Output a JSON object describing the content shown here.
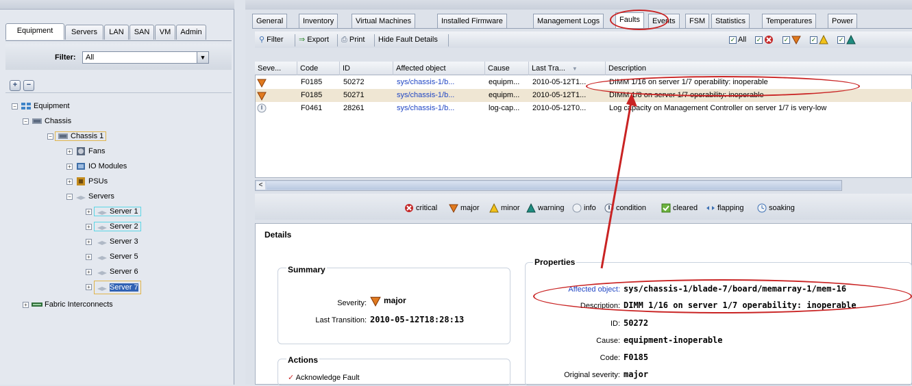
{
  "left_tabs": [
    "Equipment",
    "Servers",
    "LAN",
    "SAN",
    "VM",
    "Admin"
  ],
  "filter": {
    "label": "Filter:",
    "value": "All"
  },
  "tree": {
    "root": "Equipment",
    "chassis": "Chassis",
    "chassis1": "Chassis 1",
    "fans": "Fans",
    "io": "IO Modules",
    "psus": "PSUs",
    "servers": "Servers",
    "server_items": [
      "Server 1",
      "Server 2",
      "Server 3",
      "Server 5",
      "Server 6",
      "Server 7"
    ],
    "fabric": "Fabric Interconnects"
  },
  "tabs": [
    "General",
    "Inventory",
    "Virtual Machines",
    "Installed Firmware",
    "Management Logs",
    "Faults",
    "Events",
    "FSM",
    "Statistics",
    "Temperatures",
    "Power"
  ],
  "active_tab": "Faults",
  "toolbar": {
    "filter": "Filter",
    "export": "Export",
    "print": "Print",
    "hide": "Hide Fault Details",
    "all": "All"
  },
  "table": {
    "headers": [
      "Seve...",
      "Code",
      "ID",
      "Affected object",
      "Cause",
      "Last Tra...",
      "Description"
    ],
    "rows": [
      {
        "severity": "major",
        "code": "F0185",
        "id": "50272",
        "affected": "sys/chassis-1/b...",
        "cause": "equipm...",
        "last": "2010-05-12T1...",
        "desc": "DIMM 1/16 on server 1/7 operability: inoperable"
      },
      {
        "severity": "major",
        "code": "F0185",
        "id": "50271",
        "affected": "sys/chassis-1/b...",
        "cause": "equipm...",
        "last": "2010-05-12T1...",
        "desc": "DIMM 1/8 on server 1/7 operability: inoperable"
      },
      {
        "severity": "info",
        "code": "F0461",
        "id": "28261",
        "affected": "sys/chassis-1/b...",
        "cause": "log-cap...",
        "last": "2010-05-12T0...",
        "desc": "Log capacity on Management Controller on server 1/7 is very-low"
      }
    ]
  },
  "legend": [
    "critical",
    "major",
    "minor",
    "warning",
    "info",
    "condition",
    "cleared",
    "flapping",
    "soaking"
  ],
  "details": {
    "title": "Details",
    "summary_title": "Summary",
    "severity_label": "Severity:",
    "severity_value": "major",
    "transition_label": "Last Transition:",
    "transition_value": "2010-05-12T18:28:13",
    "actions_title": "Actions",
    "ack": "Acknowledge Fault",
    "properties_title": "Properties",
    "props": [
      {
        "label": "Affected object:",
        "value": "sys/chassis-1/blade-7/board/memarray-1/mem-16"
      },
      {
        "label": "Description:",
        "value": "DIMM 1/16 on server 1/7 operability: inoperable"
      },
      {
        "label": "ID:",
        "value": "50272"
      },
      {
        "label": "Cause:",
        "value": "equipment-inoperable"
      },
      {
        "label": "Code:",
        "value": "F0185"
      },
      {
        "label": "Original severity:",
        "value": "major"
      }
    ]
  },
  "colors": {
    "highlight": "#c92323",
    "selected": "#3162b4",
    "link": "#1f45c4"
  }
}
